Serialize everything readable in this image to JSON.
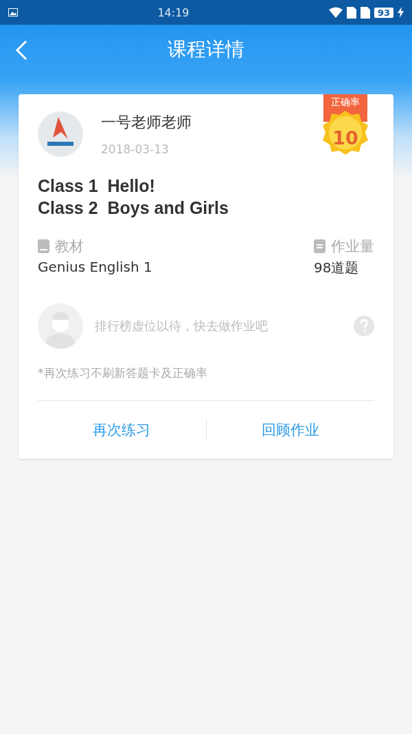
{
  "status_bar": {
    "time": "14:19",
    "battery": "93"
  },
  "header": {
    "title": "课程详情"
  },
  "course": {
    "teacher": "一号老师老师",
    "date": "2018-03-13",
    "accuracy": {
      "label": "正确率",
      "value": "10"
    },
    "lessons": [
      "Class 1  Hello!",
      "Class 2  Boys and Girls"
    ],
    "info": [
      {
        "kind": "book",
        "label": "教材",
        "value": "Genius English 1"
      },
      {
        "kind": "sheet",
        "label": "作业量",
        "value": "98道题"
      }
    ],
    "leaderboard": {
      "text": "排行榜虚位以待，快去做作业吧"
    },
    "note": "*再次练习不刷新答题卡及正确率",
    "buttons": [
      "再次练习",
      "回顾作业"
    ]
  }
}
